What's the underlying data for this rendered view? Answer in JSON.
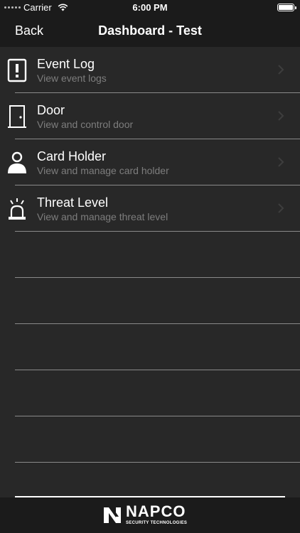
{
  "status_bar": {
    "carrier": "Carrier",
    "time": "6:00 PM"
  },
  "nav": {
    "back_label": "Back",
    "title": "Dashboard - Test"
  },
  "menu": {
    "items": [
      {
        "title": "Event Log",
        "subtitle": "View event logs",
        "icon": "alert-document-icon"
      },
      {
        "title": "Door",
        "subtitle": "View and control door",
        "icon": "door-icon"
      },
      {
        "title": "Card Holder",
        "subtitle": "View and manage card holder",
        "icon": "person-icon"
      },
      {
        "title": "Threat Level",
        "subtitle": "View and manage threat level",
        "icon": "alarm-siren-icon"
      }
    ]
  },
  "footer": {
    "brand": "NAPCO",
    "tagline": "SECURITY TECHNOLOGIES"
  }
}
